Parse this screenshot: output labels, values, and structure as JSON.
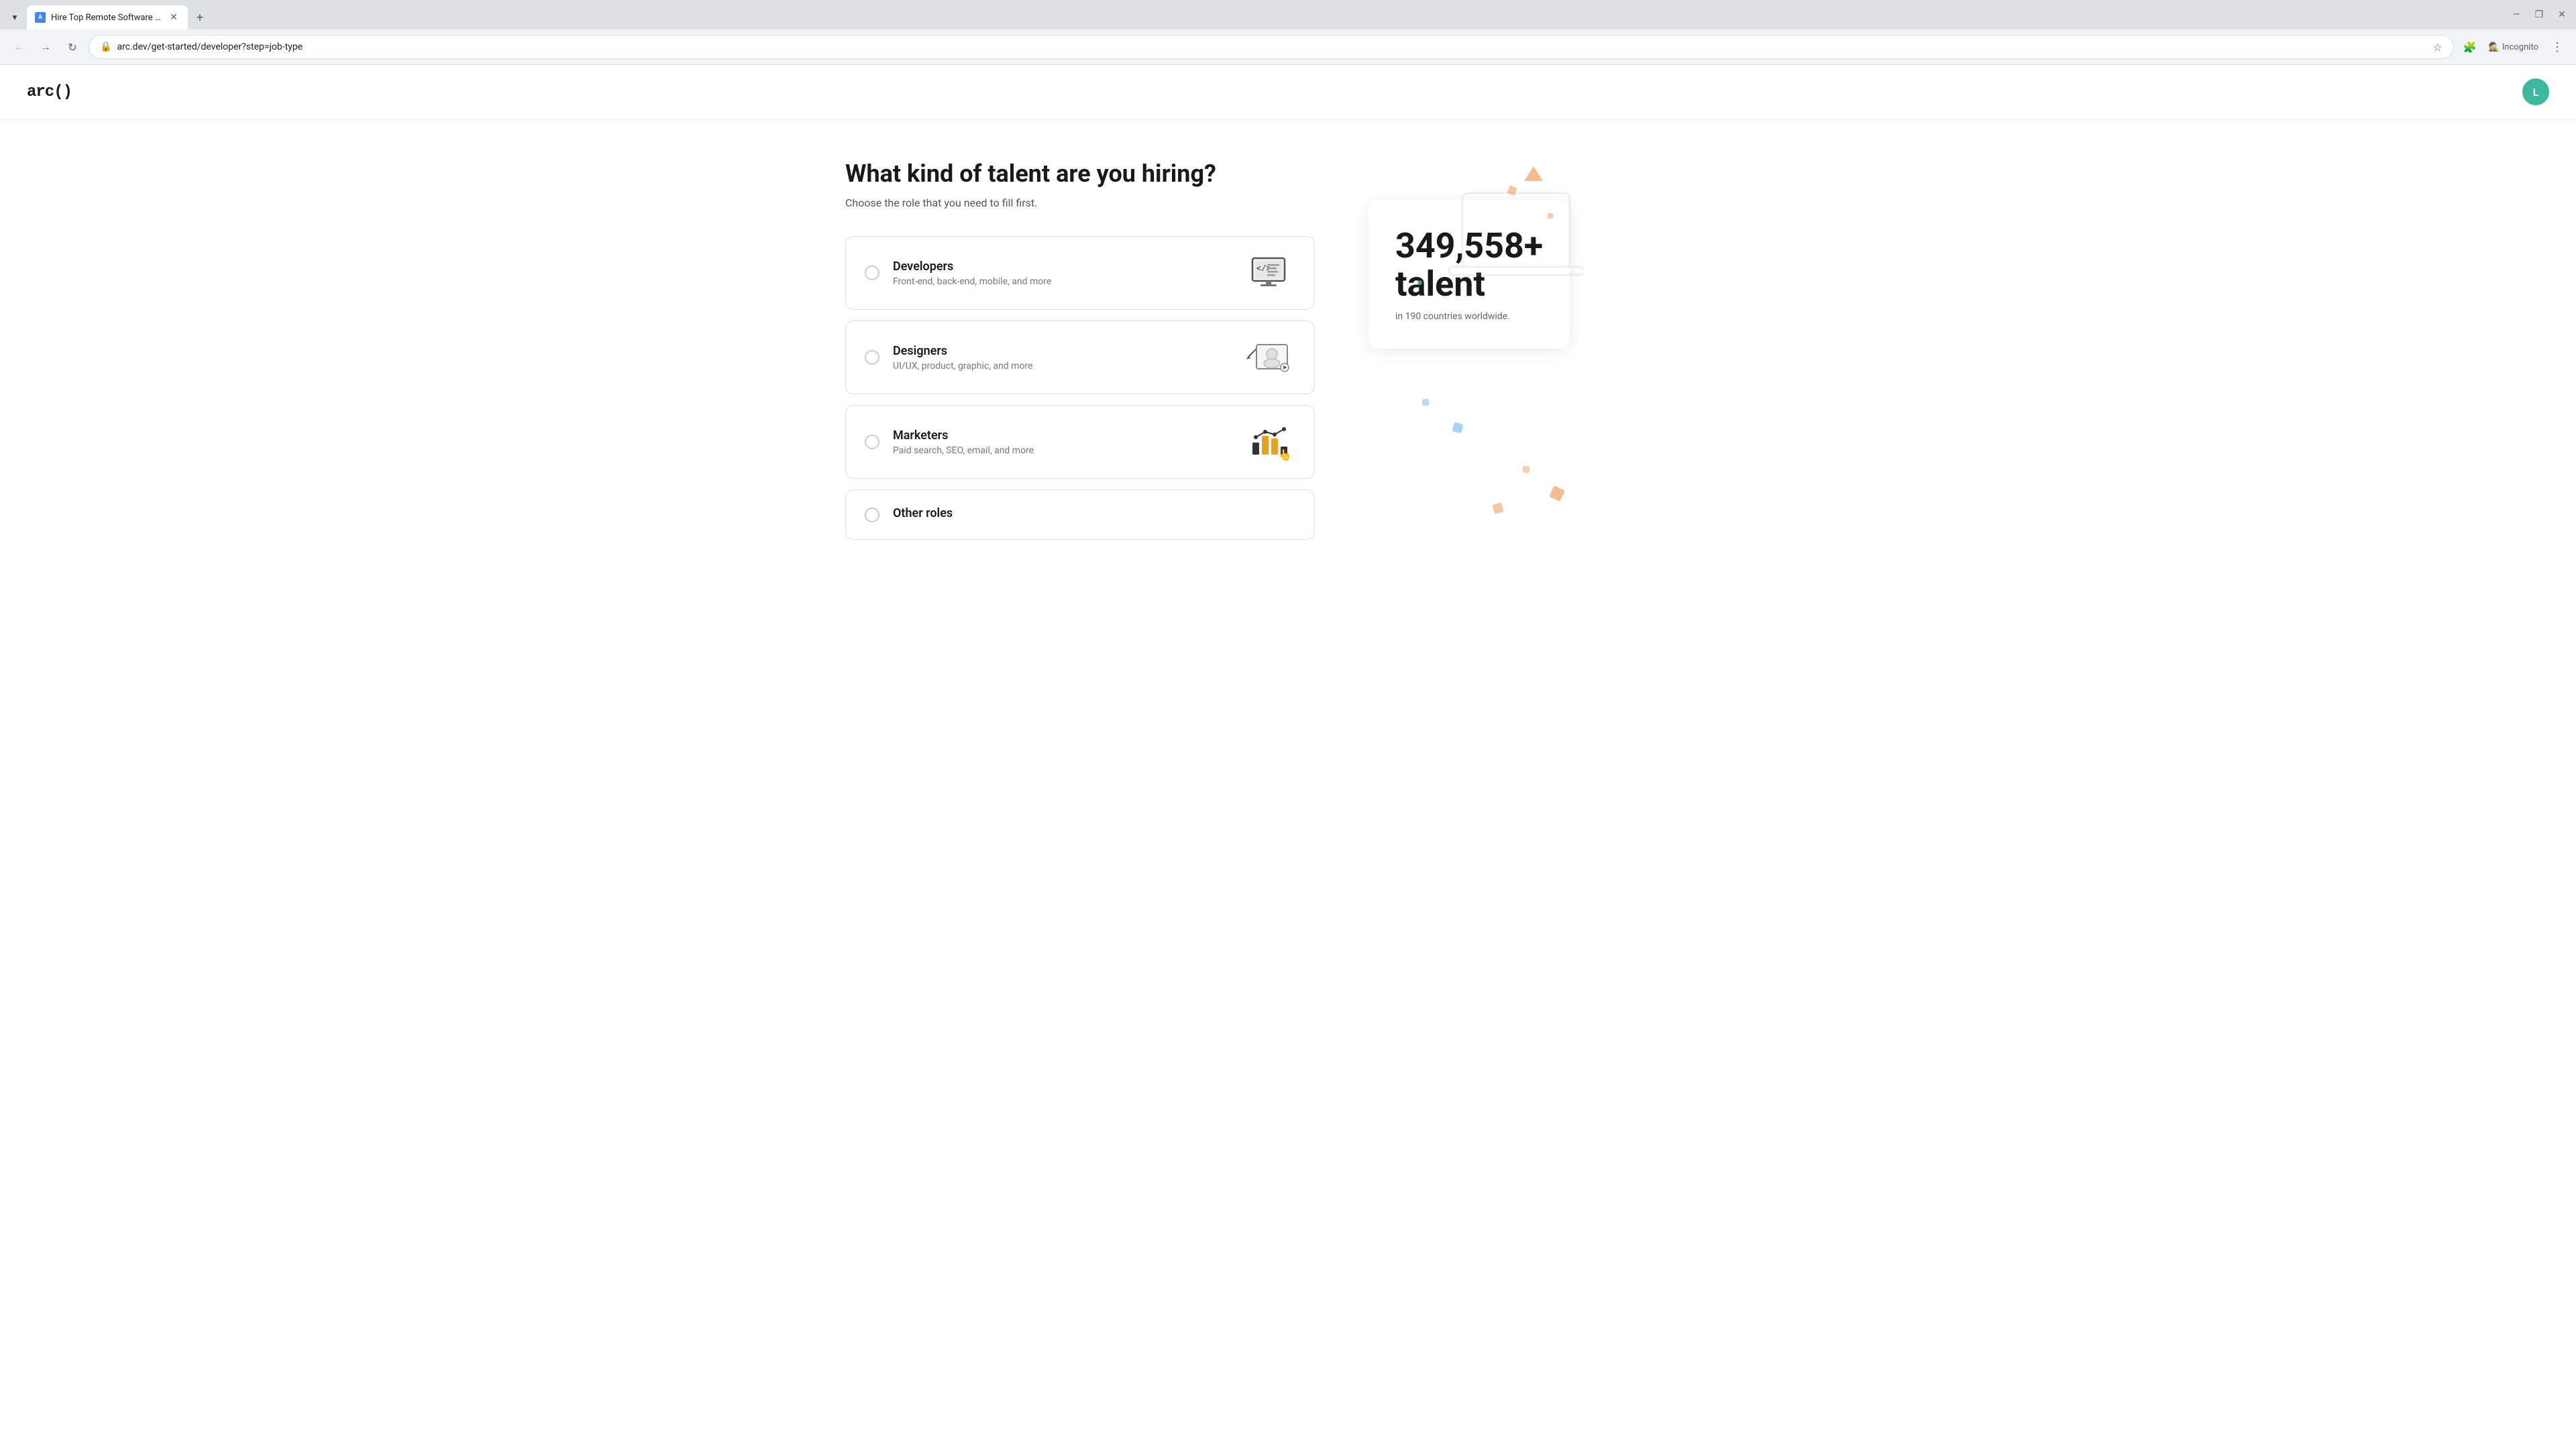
{
  "browser": {
    "tab": {
      "favicon_text": "A",
      "title": "Hire Top Remote Software Dev..."
    },
    "address": "arc.dev/get-started/developer?step=job-type",
    "incognito_label": "Incognito",
    "window_controls": {
      "minimize": "—",
      "maximize": "❐",
      "close": "✕"
    }
  },
  "header": {
    "logo": "arc()",
    "user_initial": "L"
  },
  "page": {
    "title": "What kind of talent are you hiring?",
    "subtitle": "Choose the role that you need to fill first.",
    "options": [
      {
        "id": "developers",
        "title": "Developers",
        "description": "Front-end, back-end, mobile, and more"
      },
      {
        "id": "designers",
        "title": "Designers",
        "description": "UI/UX, product, graphic, and more"
      },
      {
        "id": "marketers",
        "title": "Marketers",
        "description": "Paid search, SEO, email, and more"
      },
      {
        "id": "other",
        "title": "Other roles",
        "description": ""
      }
    ]
  },
  "stats": {
    "number": "349,558+",
    "label": "talent",
    "description": "in 190 countries worldwide."
  }
}
